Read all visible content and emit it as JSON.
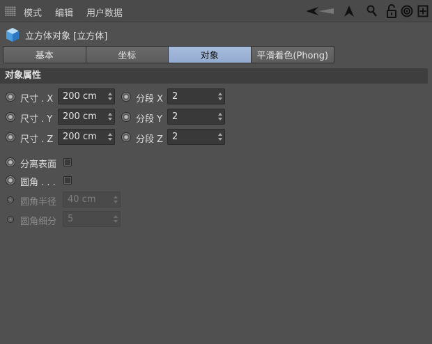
{
  "menubar": {
    "items": [
      "模式",
      "编辑",
      "用户数据"
    ],
    "icons": [
      "back-arrow-icon",
      "pointer-arrow-icon",
      "search-icon",
      "unlock-icon",
      "target-icon",
      "add-panel-icon"
    ]
  },
  "object": {
    "title": "立方体对象 [立方体]",
    "icon": "cube-icon"
  },
  "tabs": [
    {
      "label": "基本",
      "active": false
    },
    {
      "label": "坐标",
      "active": false
    },
    {
      "label": "对象",
      "active": true
    },
    {
      "label": "平滑着色(Phong)",
      "active": false
    }
  ],
  "section": {
    "title": "对象属性"
  },
  "size": [
    {
      "label": "尺寸 . X",
      "value": "200 cm"
    },
    {
      "label": "尺寸 . Y",
      "value": "200 cm"
    },
    {
      "label": "尺寸 . Z",
      "value": "200 cm"
    }
  ],
  "segments": [
    {
      "label": "分段 X",
      "value": "2"
    },
    {
      "label": "分段 Y",
      "value": "2"
    },
    {
      "label": "分段 Z",
      "value": "2"
    }
  ],
  "separate_surfaces": {
    "label": "分离表面",
    "checked": false
  },
  "fillet": {
    "label": "圆角 . . .",
    "checked": false
  },
  "fillet_radius": {
    "label": "圆角半径",
    "value": "40 cm"
  },
  "fillet_subdivision": {
    "label": "圆角细分",
    "value": "5"
  },
  "colors": {
    "accent": "#9ab1d6",
    "background": "#505050"
  }
}
